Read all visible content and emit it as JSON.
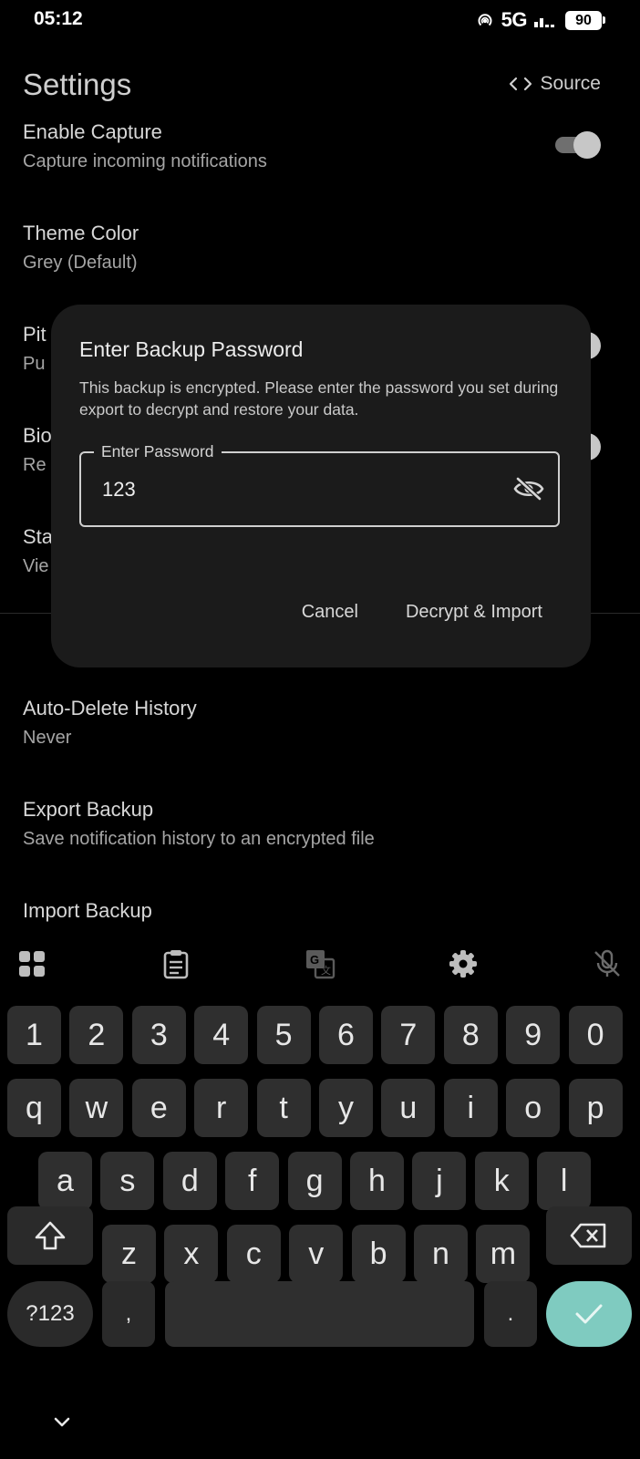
{
  "status_bar": {
    "time": "05:12",
    "network": "5G",
    "battery": "90"
  },
  "app_bar": {
    "title": "Settings",
    "source_label": "Source"
  },
  "settings": {
    "items": [
      {
        "title": "Enable Capture",
        "subtitle": "Capture incoming notifications",
        "has_switch": true
      },
      {
        "title": "Theme Color",
        "subtitle": "Grey (Default)",
        "has_switch": false
      },
      {
        "title": "Pit",
        "subtitle": "Pu",
        "has_switch": true
      },
      {
        "title": "Bio",
        "subtitle": "Re",
        "has_switch": true
      },
      {
        "title": "Sta",
        "subtitle": "Vie",
        "has_switch": false
      },
      {
        "title": "Auto-Delete History",
        "subtitle": "Never",
        "has_switch": false
      },
      {
        "title": "Export Backup",
        "subtitle": "Save notification history to an encrypted file",
        "has_switch": false
      },
      {
        "title": "Import Backup",
        "subtitle": "",
        "has_switch": false
      }
    ]
  },
  "dialog": {
    "title": "Enter Backup Password",
    "message": "This backup is encrypted. Please enter the password you set during export to decrypt and restore your data.",
    "field_label": "Enter Password",
    "field_value": "123",
    "cancel_label": "Cancel",
    "confirm_label": "Decrypt & Import"
  },
  "keyboard": {
    "toolbar": [
      "apps-grid-icon",
      "clipboard-icon",
      "translate-icon",
      "gear-icon",
      "mic-off-icon"
    ],
    "rows": [
      [
        "1",
        "2",
        "3",
        "4",
        "5",
        "6",
        "7",
        "8",
        "9",
        "0"
      ],
      [
        "q",
        "w",
        "e",
        "r",
        "t",
        "y",
        "u",
        "i",
        "o",
        "p"
      ],
      [
        "a",
        "s",
        "d",
        "f",
        "g",
        "h",
        "j",
        "k",
        "l"
      ],
      [
        "z",
        "x",
        "c",
        "v",
        "b",
        "n",
        "m"
      ]
    ],
    "symbols_label": "?123",
    "comma": ",",
    "period": "."
  },
  "colors": {
    "background": "#000000",
    "dialog_surface": "#1b1b1b",
    "key": "#2f2f2f",
    "enter_key": "#7fcbc0"
  }
}
